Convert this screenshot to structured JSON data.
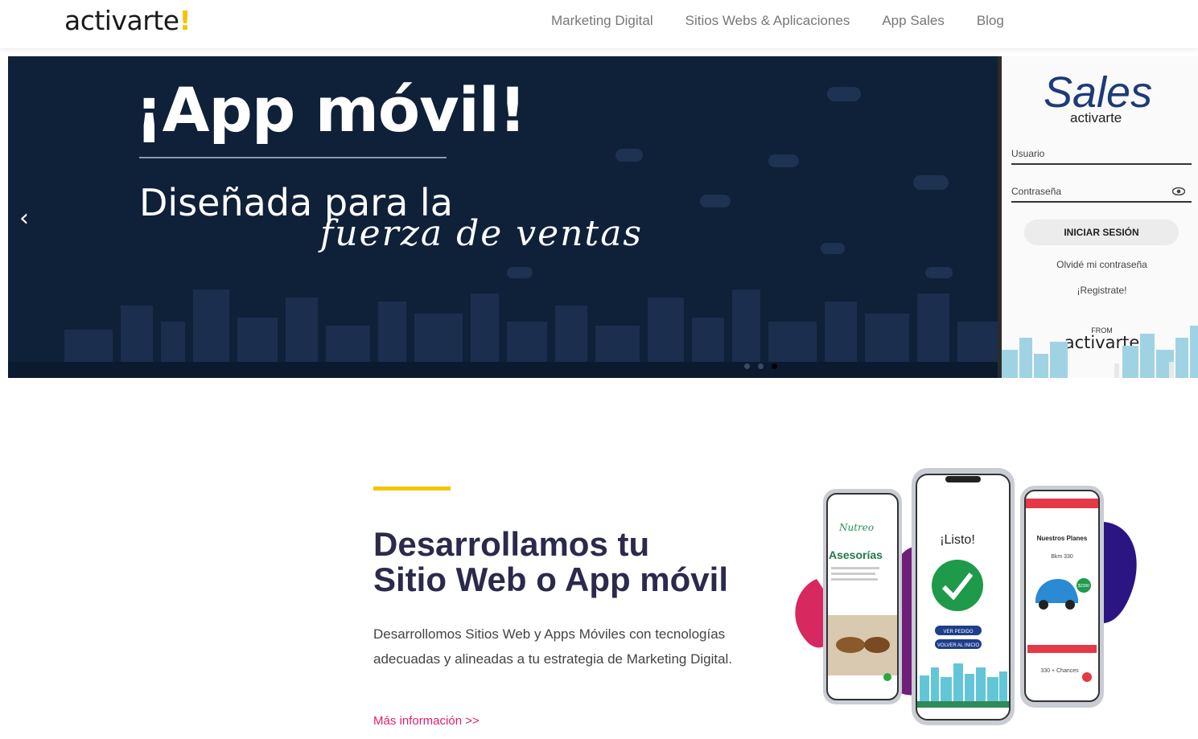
{
  "header": {
    "logo_text": "activarte",
    "logo_bang": "!",
    "nav": [
      "Marketing Digital",
      "Sitios Webs & Aplicaciones",
      "App Sales",
      "Blog"
    ]
  },
  "slider": {
    "title": "¡App móvil!",
    "subtitle": "Diseñada para la",
    "script": "fuerza de ventas",
    "prev_arrow": "‹",
    "dots_count": 3,
    "active_dot": 2,
    "login": {
      "brand": "Sales",
      "brand_sub": "activarte",
      "user_label": "Usuario",
      "pass_label": "Contraseña",
      "button": "INICIAR SESIÓN",
      "forgot": "Olvidé mi contraseña",
      "register": "¡Registrate!",
      "from": "FROM",
      "from_brand": "activarte"
    }
  },
  "section": {
    "title_line1": "Desarrollamos tu",
    "title_line2": "Sitio Web o App móvil",
    "text": "Desarrollomos Sitios Web y Apps Móviles con tecnologías adecuadas y alineadas a tu estrategia de Marketing Digital.",
    "more": "Más información >>"
  },
  "phones": {
    "left_screen_title": "Asesorías",
    "left_screen_brand": "Nutreo",
    "center_screen_title": "¡Listo!",
    "center_btn1": "VER PEDIDO",
    "center_btn2": "VOLVER AL INICIO",
    "right_screen_title": "Nuestros Planes",
    "right_screen_sub": "Bkm 330",
    "right_price": "$2390",
    "right_footer": "330 + Chances"
  },
  "colors": {
    "accent": "#f5c400",
    "title": "#2b2a4c",
    "link": "#e01e6b",
    "slider_bg": "#0f2039"
  }
}
